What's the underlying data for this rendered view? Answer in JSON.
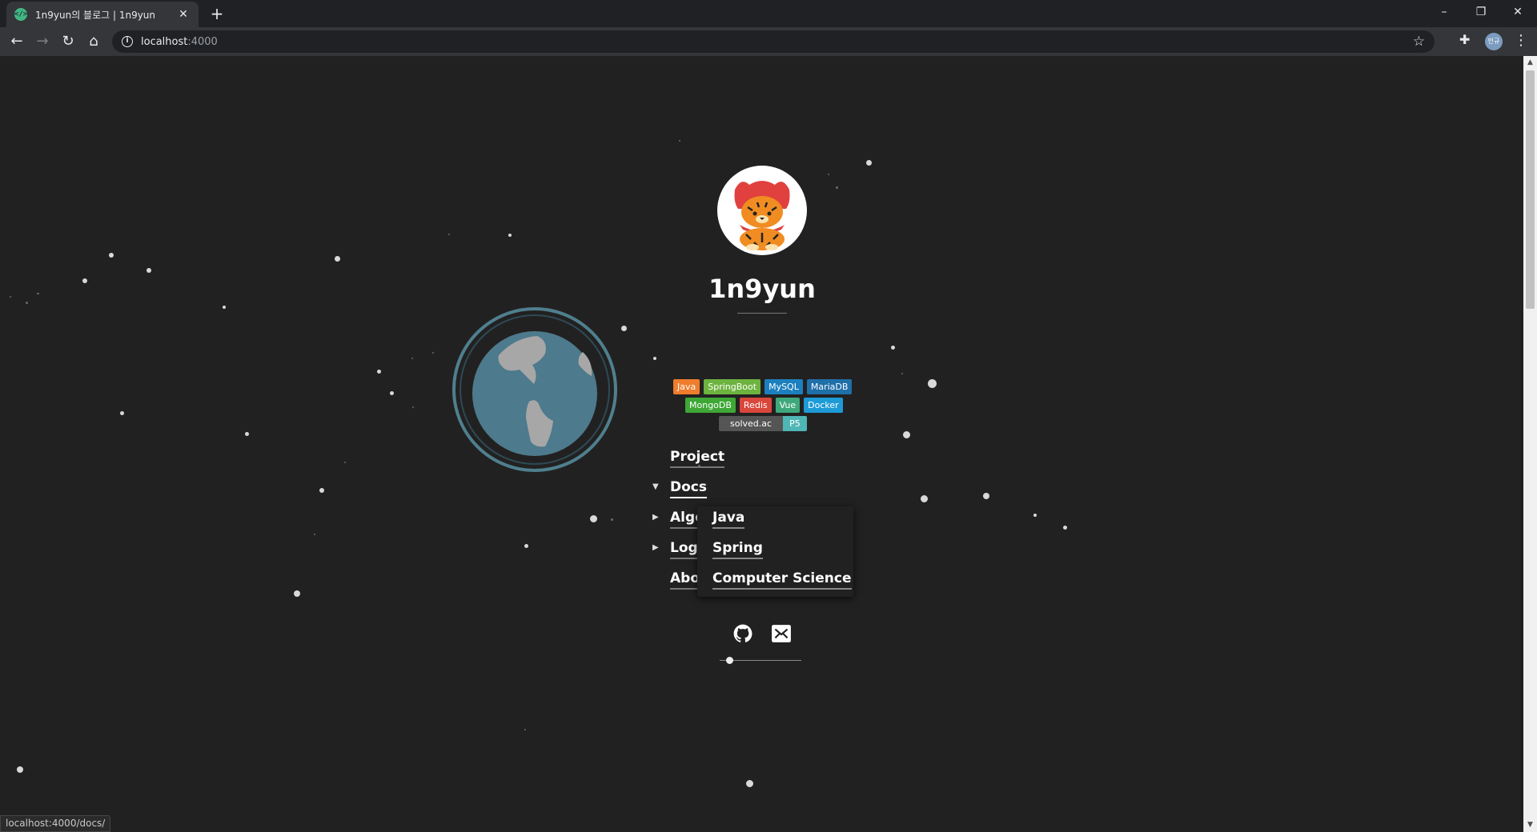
{
  "browser": {
    "tab_title": "1n9yun의 블로그 | 1n9yun",
    "tab_favicon": "</>",
    "url_host": "localhost",
    "url_port": ":4000",
    "profile_label": "인규",
    "status_url": "localhost:4000/docs/"
  },
  "site": {
    "title": "1n9yun",
    "badges_row1": [
      {
        "label": "Java",
        "color": "#ef7d2c"
      },
      {
        "label": "SpringBoot",
        "color": "#6db33f"
      },
      {
        "label": "MySQL",
        "color": "#1c80bf"
      },
      {
        "label": "MariaDB",
        "color": "#1f6fa8"
      }
    ],
    "badges_row2": [
      {
        "label": "MongoDB",
        "color": "#3ea736"
      },
      {
        "label": "Redis",
        "color": "#d9463b"
      },
      {
        "label": "Vue",
        "color": "#3fa87a"
      },
      {
        "label": "Docker",
        "color": "#1d9bd6"
      }
    ],
    "solved_left": "solved.ac",
    "solved_right": "P5"
  },
  "nav": {
    "project": "Project",
    "docs": "Docs",
    "algo": "Algo",
    "log": "Log",
    "about": "About"
  },
  "docs_menu": {
    "java": "Java",
    "spring": "Spring",
    "cs": "Computer Science"
  },
  "icons": {
    "github": "github-icon",
    "mail": "mail-icon"
  }
}
